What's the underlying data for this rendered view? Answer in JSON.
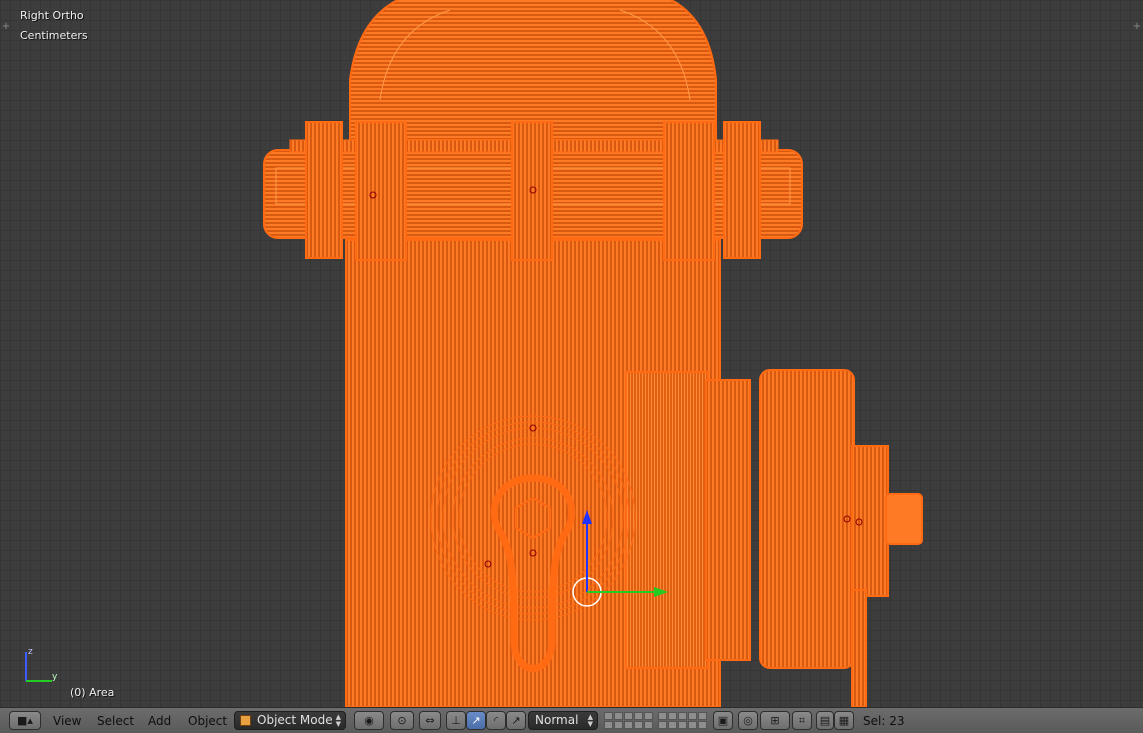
{
  "viewport": {
    "view_name": "Right Ortho",
    "units": "Centimeters",
    "object_info": "(0) Area",
    "axis_labels": {
      "z": "z",
      "y": "y"
    },
    "wire_color": "#ff6a13",
    "background_color": "#3d3d3d"
  },
  "header": {
    "editor_type_icon": "cube-icon",
    "menus": {
      "view": "View",
      "select": "Select",
      "add": "Add",
      "object": "Object"
    },
    "mode": "Object Mode",
    "pivot_icon": "pivot-point-icon",
    "snap_icons": [
      "snap-icon",
      "snap-target-icon"
    ],
    "manipulator_icons": [
      "manipulator-icon",
      "translate-icon",
      "rotate-icon",
      "scale-icon"
    ],
    "transform_orientation": "Normal",
    "selection_count": "Sel: 23"
  }
}
